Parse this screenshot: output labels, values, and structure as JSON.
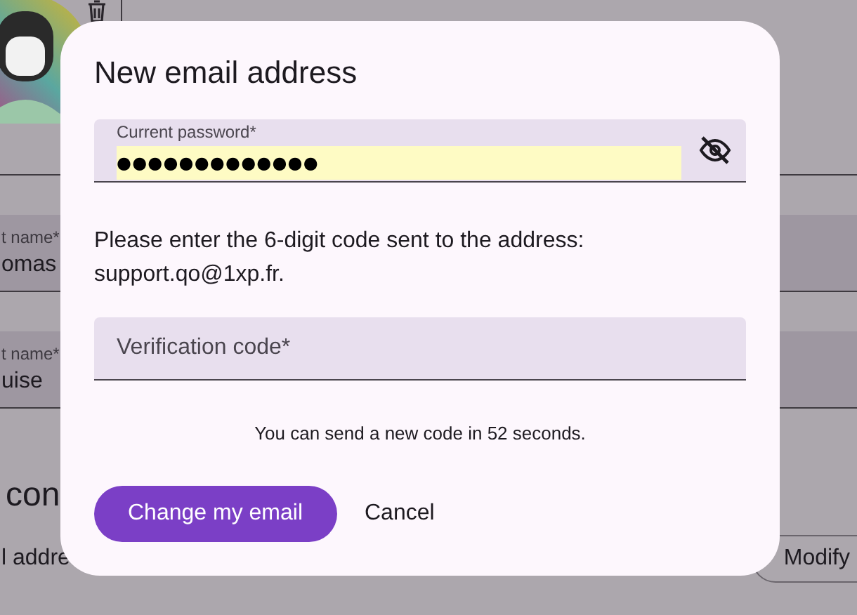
{
  "background": {
    "fields": [
      {
        "label": "t name*",
        "value": "omas"
      },
      {
        "label": "t name*",
        "value": "uise"
      }
    ],
    "heading": "con",
    "row_label": "l addre",
    "modify_button": "Modify"
  },
  "dialog": {
    "title": "New email address",
    "password": {
      "label": "Current password*",
      "value": "●●●●●●●●●●●●●"
    },
    "message": "Please enter the 6-digit code sent to the address:",
    "email": "support.qo@1xp.fr.",
    "code": {
      "placeholder": "Verification code*"
    },
    "timer": "You can send a new code in 52 seconds.",
    "buttons": [
      {
        "label": "Change my email",
        "kind": "primary"
      },
      {
        "label": "Cancel",
        "kind": "text"
      }
    ]
  }
}
